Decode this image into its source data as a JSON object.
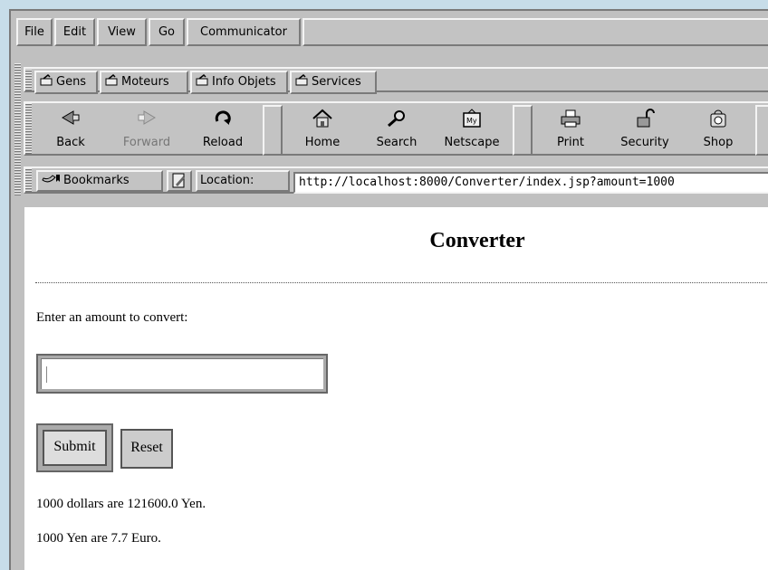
{
  "menu": [
    "File",
    "Edit",
    "View",
    "Go",
    "Communicator"
  ],
  "personal_toolbar": [
    "Gens",
    "Moteurs",
    "Info Objets",
    "Services"
  ],
  "navigation": {
    "back": "Back",
    "forward": "Forward",
    "reload": "Reload",
    "home": "Home",
    "search": "Search",
    "netscape": "Netscape",
    "print": "Print",
    "security": "Security",
    "shop": "Shop"
  },
  "location_bar": {
    "bookmarks_label": "Bookmarks",
    "location_label": "Location:",
    "url": "http://localhost:8000/Converter/index.jsp?amount=1000"
  },
  "page": {
    "title": "Converter",
    "prompt": "Enter an amount to convert:",
    "amount_value": "",
    "submit_label": "Submit",
    "reset_label": "Reset",
    "result_yen": "1000 dollars are 121600.0 Yen.",
    "result_euro": "1000 Yen are 7.7 Euro."
  },
  "icons": {
    "back": "back-arrow-icon",
    "forward": "forward-arrow-icon",
    "reload": "reload-icon",
    "home": "home-icon",
    "search": "search-icon",
    "netscape": "my-netscape-icon",
    "print": "printer-icon",
    "security": "padlock-icon",
    "shop": "shop-icon",
    "bookmark": "bookmark-icon",
    "folder": "folder-icon"
  }
}
